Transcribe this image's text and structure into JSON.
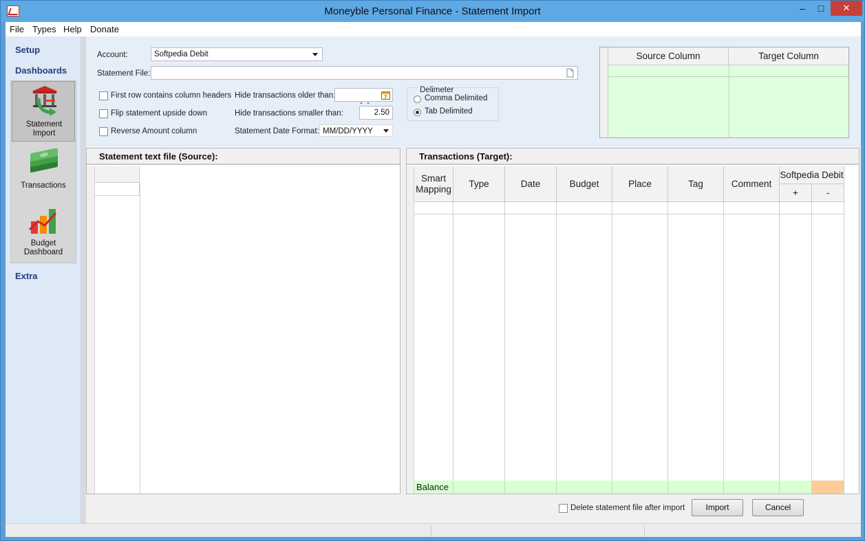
{
  "window": {
    "title": "Moneyble Personal Finance - Statement Import"
  },
  "menu": [
    "File",
    "Types",
    "Help",
    "Donate"
  ],
  "sidebar": {
    "setup_label": "Setup",
    "dashboards_label": "Dashboards",
    "extra_label": "Extra",
    "items": [
      {
        "label_line1": "Statement",
        "label_line2": "Import",
        "icon": "bank-import-icon",
        "active": true
      },
      {
        "label_line1": "Transactions",
        "label_line2": "",
        "icon": "money-stack-icon",
        "active": false
      },
      {
        "label_line1": "Budget",
        "label_line2": "Dashboard",
        "icon": "budget-chart-icon",
        "active": false
      }
    ]
  },
  "form": {
    "account_label": "Account:",
    "account_value": "Softpedia Debit",
    "file_label": "Statement File:",
    "file_value": "",
    "first_row_label": "First row contains column headers",
    "flip_label": "Flip statement upside down",
    "reverse_label": "Reverse Amount column",
    "hide_older_label": "Hide transactions older than:",
    "hide_older_value": "  -  -",
    "hide_smaller_label": "Hide transactions smaller than:",
    "hide_smaller_value": "2.50",
    "date_format_label": "Statement Date Format:",
    "date_format_value": "MM/DD/YYYY",
    "delimiter_title": "Delimeter",
    "comma_label": "Comma Delimited",
    "tab_label": "Tab Delimited",
    "selected_delimiter": "tab"
  },
  "mapping": {
    "source_header": "Source Column",
    "target_header": "Target Column"
  },
  "source_panel": {
    "title": "Statement text file (Source):"
  },
  "target_panel": {
    "title": "Transactions (Target):",
    "columns": [
      "Smart\nMapping",
      "Type",
      "Date",
      "Budget",
      "Place",
      "Tag",
      "Comment"
    ],
    "account_header": "Softpedia Debit",
    "plus_label": "+",
    "minus_label": "-",
    "balance_label": "Balance",
    "colors": {
      "balance_row": "#d9ffd3",
      "negative_cell": "#ffcc99"
    }
  },
  "bottom": {
    "delete_label": "Delete statement file after import",
    "import_label": "Import",
    "cancel_label": "Cancel"
  }
}
